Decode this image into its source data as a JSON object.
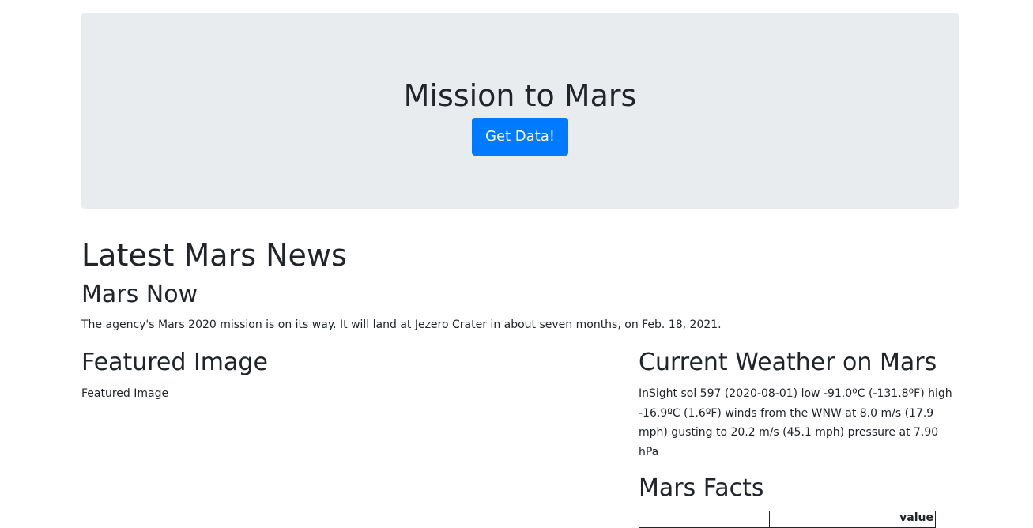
{
  "jumbotron": {
    "title": "Mission to Mars",
    "button_label": "Get Data!"
  },
  "news": {
    "section_title": "Latest Mars News",
    "headline": "Mars Now",
    "teaser": "The agency's Mars 2020 mission is on its way. It will land at Jezero Crater in about seven months, on Feb. 18, 2021."
  },
  "featured": {
    "title": "Featured Image",
    "image_alt": "Featured Image"
  },
  "weather": {
    "title": "Current Weather on Mars",
    "report": "InSight sol 597 (2020-08-01) low -91.0ºC (-131.8ºF) high -16.9ºC (1.6ºF) winds from the WNW at 8.0 m/s (17.9 mph) gusting to 20.2 m/s (45.1 mph) pressure at 7.90 hPa"
  },
  "facts": {
    "title": "Mars Facts",
    "columns": [
      "",
      "value"
    ]
  },
  "colors": {
    "jumbotron_bg": "#e9ecef",
    "primary": "#007bff",
    "text": "#212529"
  }
}
